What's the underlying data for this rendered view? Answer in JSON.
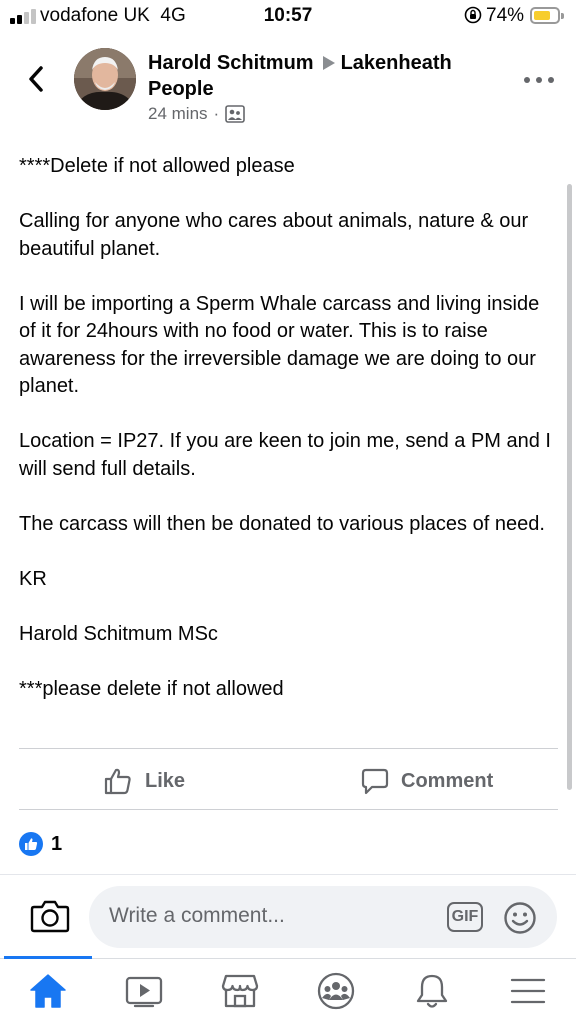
{
  "status_bar": {
    "carrier": "vodafone UK",
    "network": "4G",
    "time": "10:57",
    "battery_percent": "74%",
    "battery_level": 0.74,
    "signal_bars_filled": 2,
    "signal_bars_total": 4
  },
  "header": {
    "back_icon": "chevron-left-icon",
    "author_name": "Harold Schitmum",
    "separator_icon": "right-triangle-icon",
    "group_name": "Lakenheath People",
    "timestamp": "24 mins",
    "meta_separator": "·",
    "privacy_icon": "group-members-icon",
    "more_icon": "more-horizontal-icon"
  },
  "post": {
    "paragraphs": [
      "****Delete if not allowed please",
      "Calling for anyone who cares about animals, nature & our beautiful planet.",
      "I will be importing a Sperm Whale carcass and living inside of it for 24hours with no food or water. This is to raise awareness for the irreversible damage we are doing to our planet.",
      "Location = IP27. If you are keen to join me, send a PM and I will send full details.",
      "The carcass will then be donated to various places of need.",
      "KR",
      "Harold Schitmum MSc",
      "***please delete if not allowed"
    ]
  },
  "actions": {
    "like_label": "Like",
    "comment_label": "Comment"
  },
  "reactions": {
    "count": "1",
    "icon": "thumbs-up-icon"
  },
  "composer": {
    "placeholder": "Write a comment...",
    "gif_label": "GIF",
    "camera_icon": "camera-icon",
    "emoji_icon": "smiley-icon"
  },
  "bottom_nav": {
    "items": [
      "home-icon",
      "video-icon",
      "marketplace-icon",
      "groups-icon",
      "notifications-icon",
      "menu-icon"
    ],
    "active": "home-icon"
  },
  "colors": {
    "accent": "#1877f2",
    "secondary_text": "#65676b",
    "battery": "#f7cd2c",
    "composer_bg": "#f0f2f5"
  }
}
